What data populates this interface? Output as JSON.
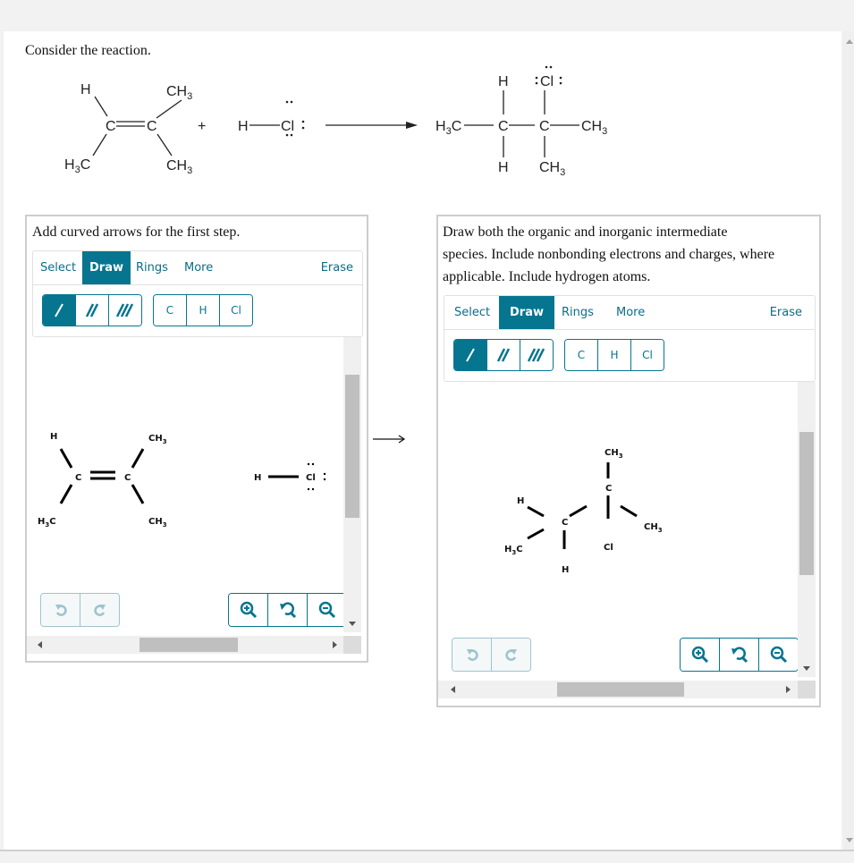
{
  "question": {
    "prompt": "Consider the reaction.",
    "reaction": {
      "reactant1": {
        "labels": {
          "top_left": "H",
          "top_right": "CH3",
          "bottom_left": "H3C",
          "bottom_right": "CH3",
          "c1": "C",
          "c2": "C"
        }
      },
      "plus": "+",
      "reactant2": {
        "h": "H",
        "cl": "Cl"
      },
      "product": {
        "h_top": "H",
        "cl": "Cl",
        "h3c": "H3C",
        "c1": "C",
        "c2": "C",
        "ch3_right": "CH3",
        "h_bottom": "H",
        "ch3_bottom": "CH3"
      }
    }
  },
  "left_panel": {
    "title": "Add curved arrows for the first step.",
    "tabs": [
      "Select",
      "Draw",
      "Rings",
      "More"
    ],
    "active_tab": "Draw",
    "erase_label": "Erase",
    "bond_tools": [
      "single-bond",
      "double-bond",
      "triple-bond"
    ],
    "active_bond": "single-bond",
    "atom_tools": [
      "C",
      "H",
      "Cl"
    ],
    "molecule1": {
      "h": "H",
      "c1": "C",
      "c2": "C",
      "ch3_top": "CH",
      "ch3_bottom": "CH",
      "h3c": "H",
      "sub3": "3",
      "c_suffix": "C"
    },
    "molecule2": {
      "h": "H",
      "cl": "Cl"
    },
    "history_controls": [
      "undo",
      "redo"
    ],
    "zoom_controls": [
      "zoom-in",
      "reset-zoom",
      "zoom-out"
    ]
  },
  "right_panel": {
    "title_lines": [
      "Draw both the organic and inorganic intermediate",
      "species. Include nonbonding electrons and charges, where",
      "applicable. Include hydrogen atoms."
    ],
    "tabs": [
      "Select",
      "Draw",
      "Rings",
      "More"
    ],
    "active_tab": "Draw",
    "erase_label": "Erase",
    "bond_tools": [
      "single-bond",
      "double-bond",
      "triple-bond"
    ],
    "active_bond": "single-bond",
    "atom_tools": [
      "C",
      "H",
      "Cl"
    ],
    "molecule": {
      "ch3_top": "CH",
      "c_top": "C",
      "h": "H",
      "c_mid": "C",
      "ch3_right": "CH",
      "h3c": "H",
      "cl": "Cl",
      "h_bottom": "H",
      "sub3": "3",
      "c_suffix": "C"
    },
    "history_controls": [
      "undo",
      "redo"
    ],
    "zoom_controls": [
      "zoom-in",
      "reset-zoom",
      "zoom-out"
    ]
  },
  "colors": {
    "accent": "#067590",
    "disabled": "#9ec4cf",
    "panel_border": "#cdcdcd"
  }
}
